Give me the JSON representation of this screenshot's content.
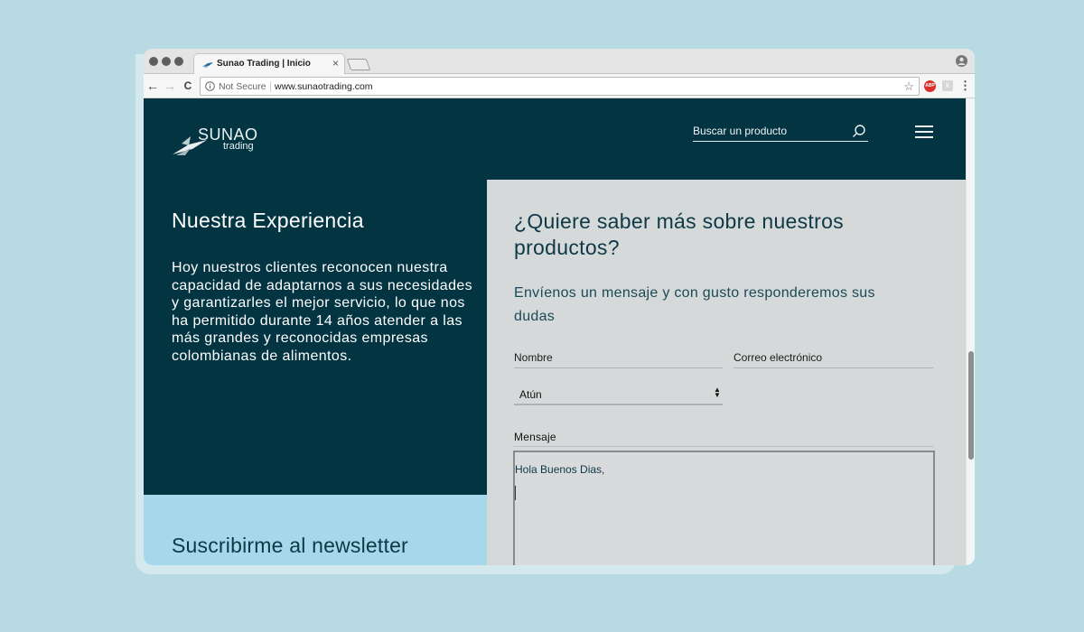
{
  "browser": {
    "tab_title": "Sunao Trading | Inicio",
    "tab_close": "×",
    "security_label": "Not Secure",
    "url": "www.sunaotrading.com",
    "back_glyph": "←",
    "forward_glyph": "→",
    "reload_glyph": "C",
    "star_glyph": "☆",
    "menu_glyph": "⋮",
    "ext_adblock_label": "ABP",
    "ext_2_label": "k"
  },
  "header": {
    "logo_word": "SUNAO",
    "logo_sub": "trading",
    "search_placeholder": "Buscar un producto"
  },
  "experience": {
    "title": "Nuestra Experiencia",
    "text": "Hoy nuestros clientes reconocen nuestra capacidad de adaptarnos a sus necesidades y garantizarles el mejor servicio, lo que nos ha permitido durante 14 años atender a las más grandes y reconocidas empresas colombianas de alimentos."
  },
  "newsletter": {
    "title": "Suscribirme al newsletter"
  },
  "contact_form": {
    "title": "¿Quiere saber más sobre nuestros productos?",
    "subtitle": "Envíenos un mensaje y con gusto responderemos sus dudas",
    "name_placeholder": "Nombre",
    "email_placeholder": "Correo electrónico",
    "product_selected": "Atún",
    "select_arrows": "▲▼",
    "message_label": "Mensaje",
    "message_value": "Hola Buenos Dias,"
  },
  "colors": {
    "brand_dark": "#023442",
    "newsletter_bg": "#a4d8ea",
    "form_bg": "#d6d9d9",
    "page_bg": "#b8dbe3"
  }
}
